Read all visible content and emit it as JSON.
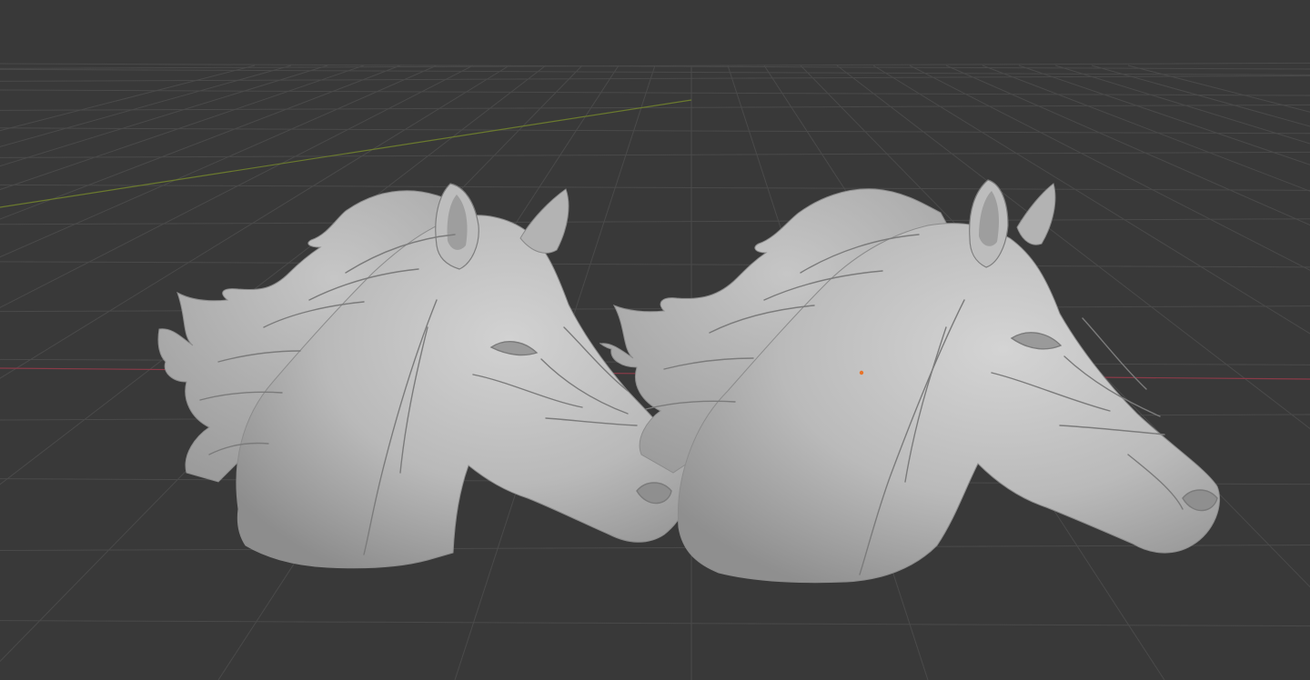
{
  "viewport": {
    "background": "#393939",
    "grid_color": "#4a4a4a",
    "x_axis_color": "#8a3a48",
    "y_axis_color": "#6b7a2e",
    "object_origin_color": "#e8742a"
  },
  "scene": {
    "objects": [
      {
        "name": "horse-head-bust-left",
        "material_color": "#b8b8b8",
        "selected": false
      },
      {
        "name": "horse-head-bust-right",
        "material_color": "#b8b8b8",
        "selected": false
      }
    ]
  }
}
